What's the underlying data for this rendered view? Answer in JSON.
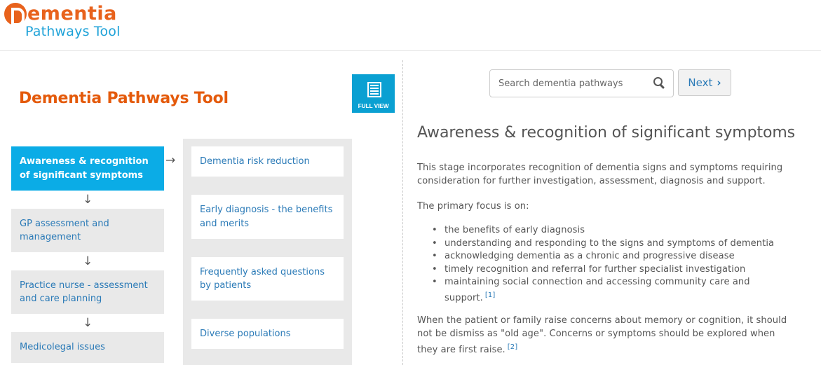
{
  "header": {
    "logo_main": "ementia",
    "logo_sub": "Pathways Tool"
  },
  "left": {
    "title": "Dementia Pathways Tool",
    "full_view_label": "FULL VIEW",
    "full_view_icon": "list-icon",
    "stages": [
      {
        "label": "Awareness & recognition of significant symptoms",
        "active": true
      },
      {
        "label": "GP assessment and management",
        "active": false
      },
      {
        "label": "Practice nurse - assessment and care planning",
        "active": false
      },
      {
        "label": "Medicolegal issues",
        "active": false
      }
    ],
    "down_arrow": "↓",
    "right_arrow": "→",
    "sub_items": [
      {
        "label": "Dementia risk reduction"
      },
      {
        "label": "Early diagnosis - the benefits and merits"
      },
      {
        "label": "Frequently asked questions by patients"
      },
      {
        "label": "Diverse populations"
      }
    ]
  },
  "search": {
    "placeholder": "Search dementia pathways",
    "value": ""
  },
  "next_button": {
    "label": "Next",
    "icon": "›"
  },
  "content": {
    "heading": "Awareness & recognition of significant symptoms",
    "intro": "This stage incorporates recognition of dementia signs and symptoms requiring consideration for further investigation, assessment, diagnosis and support.",
    "focus_intro": "The primary focus is on:",
    "focus_items": [
      "the benefits of early diagnosis",
      "understanding and responding to the signs and symptoms of dementia",
      "acknowledging dementia as a chronic and progressive disease",
      "timely recognition and referral for further specialist investigation",
      "maintaining social connection and accessing community care and support."
    ],
    "focus_ref": "[1]",
    "concerns": "When the patient or family raise concerns about memory or cognition, it should not be dismiss as \"old age\". Concerns or symptoms should be explored when they are first raise.",
    "concerns_ref": "[2]"
  }
}
